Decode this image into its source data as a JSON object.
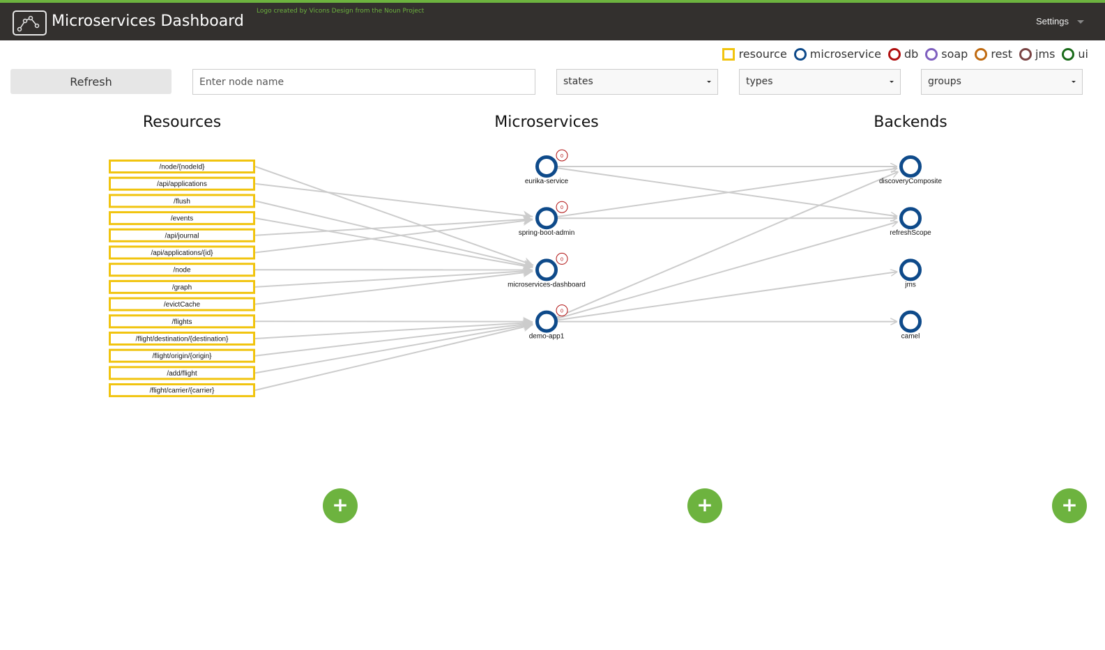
{
  "header": {
    "title": "Microservices Dashboard",
    "logo_credit": "Logo created by Vicons Design from the Noun Project",
    "settings_label": "Settings",
    "accent_color": "#6db33f",
    "bar_color": "#33302e"
  },
  "legend": [
    {
      "label": "resource",
      "shape": "square",
      "color": "#f1c40f"
    },
    {
      "label": "microservice",
      "shape": "circle",
      "color": "#0e4a8a"
    },
    {
      "label": "db",
      "shape": "circle",
      "color": "#b00f0f"
    },
    {
      "label": "soap",
      "shape": "circle",
      "color": "#7f5fbf"
    },
    {
      "label": "rest",
      "shape": "circle",
      "color": "#c06a10"
    },
    {
      "label": "jms",
      "shape": "circle",
      "color": "#7a4444"
    },
    {
      "label": "ui",
      "shape": "circle",
      "color": "#1a6b1a"
    }
  ],
  "toolbar": {
    "refresh_label": "Refresh",
    "search_placeholder": "Enter node name",
    "search_value": "",
    "states_label": "states",
    "types_label": "types",
    "groups_label": "groups"
  },
  "columns": {
    "resources": "Resources",
    "microservices": "Microservices",
    "backends": "Backends"
  },
  "resources": [
    "/node/{nodeId}",
    "/api/applications",
    "/flush",
    "/events",
    "/api/journal",
    "/api/applications/{id}",
    "/node",
    "/graph",
    "/evictCache",
    "/flights",
    "/flight/destination/{destination}",
    "/flight/origin/{origin}",
    "/add/flight",
    "/flight/carrier/{carrier}"
  ],
  "microservices": [
    {
      "name": "eurika-service",
      "badge": "0"
    },
    {
      "name": "spring-boot-admin",
      "badge": "0"
    },
    {
      "name": "microservices-dashboard",
      "badge": "0"
    },
    {
      "name": "demo-app1",
      "badge": "0"
    }
  ],
  "backends": [
    "discoveryComposite",
    "refreshScope",
    "jms",
    "camel"
  ],
  "edges_resources": [
    [
      "/node/{nodeId}",
      "microservices-dashboard"
    ],
    [
      "/api/applications",
      "spring-boot-admin"
    ],
    [
      "/flush",
      "microservices-dashboard"
    ],
    [
      "/events",
      "microservices-dashboard"
    ],
    [
      "/api/journal",
      "spring-boot-admin"
    ],
    [
      "/api/applications/{id}",
      "spring-boot-admin"
    ],
    [
      "/node",
      "microservices-dashboard"
    ],
    [
      "/graph",
      "microservices-dashboard"
    ],
    [
      "/evictCache",
      "microservices-dashboard"
    ],
    [
      "/flights",
      "demo-app1"
    ],
    [
      "/flight/destination/{destination}",
      "demo-app1"
    ],
    [
      "/flight/origin/{origin}",
      "demo-app1"
    ],
    [
      "/add/flight",
      "demo-app1"
    ],
    [
      "/flight/carrier/{carrier}",
      "demo-app1"
    ]
  ],
  "edges_backends": [
    [
      "eurika-service",
      "discoveryComposite"
    ],
    [
      "eurika-service",
      "refreshScope"
    ],
    [
      "spring-boot-admin",
      "discoveryComposite"
    ],
    [
      "spring-boot-admin",
      "refreshScope"
    ],
    [
      "demo-app1",
      "discoveryComposite"
    ],
    [
      "demo-app1",
      "refreshScope"
    ],
    [
      "demo-app1",
      "jms"
    ],
    [
      "demo-app1",
      "camel"
    ]
  ],
  "add_button_label": "+"
}
